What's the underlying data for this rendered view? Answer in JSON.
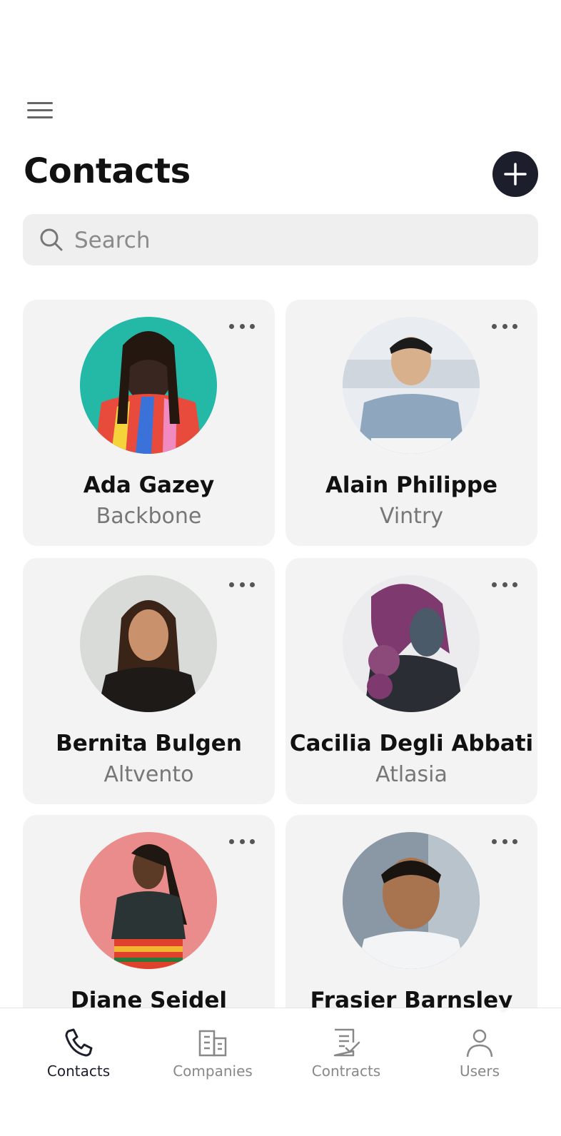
{
  "header": {
    "menu_icon": "hamburger-menu-icon",
    "title": "Contacts",
    "add_icon": "plus-icon"
  },
  "search": {
    "placeholder": "Search",
    "value": "",
    "icon": "search-icon"
  },
  "contacts": [
    {
      "name": "Ada Gazey",
      "company": "Backbone",
      "avatar_colors": [
        "#23b9a6",
        "#3a2620"
      ]
    },
    {
      "name": "Alain Philippe",
      "company": "Vintry",
      "avatar_colors": [
        "#e9edf1",
        "#8fa7be"
      ]
    },
    {
      "name": "Bernita Bulgen",
      "company": "Altvento",
      "avatar_colors": [
        "#d9dbd8",
        "#1d1a18"
      ]
    },
    {
      "name": "Cacilia Degli Abbati",
      "company": "Atlasia",
      "avatar_colors": [
        "#7e3a6f",
        "#2b2d35"
      ]
    },
    {
      "name": "Diane Seidel",
      "company": "",
      "avatar_colors": [
        "#e98c8b",
        "#2b3434"
      ]
    },
    {
      "name": "Frasier Barnsley",
      "company": "",
      "avatar_colors": [
        "#8a97a5",
        "#f2f4f6"
      ]
    }
  ],
  "tabs": [
    {
      "label": "Contacts",
      "icon": "phone-icon",
      "active": true
    },
    {
      "label": "Companies",
      "icon": "building-icon",
      "active": false
    },
    {
      "label": "Contracts",
      "icon": "document-check-icon",
      "active": false
    },
    {
      "label": "Users",
      "icon": "user-icon",
      "active": false
    }
  ],
  "colors": {
    "accent": "#1c1e2c",
    "card_bg": "#f3f3f4",
    "muted_text": "#777777"
  }
}
